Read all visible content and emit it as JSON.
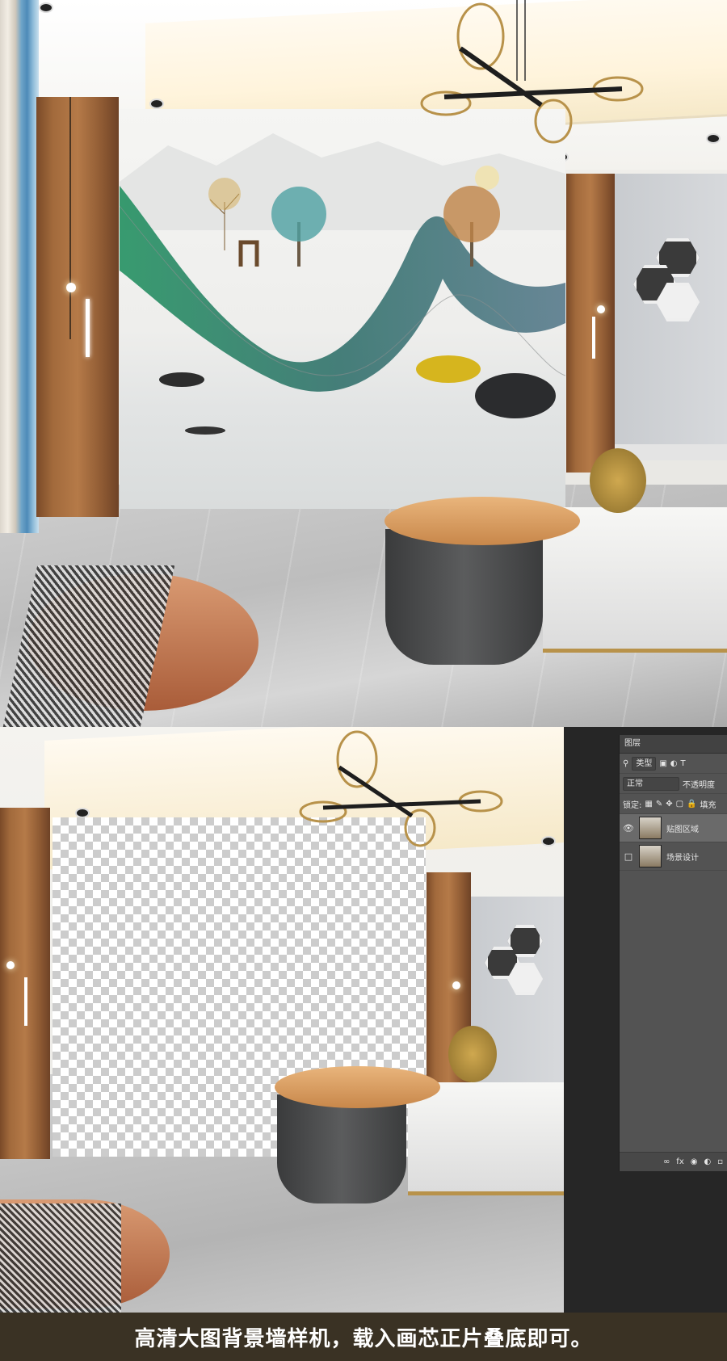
{
  "layers_panel": {
    "tab_title": "图层",
    "filter_kind": "类型",
    "blend_mode": "正常",
    "opacity_label": "不透明度",
    "lock_label": "锁定:",
    "fill_label": "填充",
    "layers": [
      {
        "name": "贴图区域",
        "visible": true,
        "selected": true
      },
      {
        "name": "场景设计",
        "visible": false,
        "selected": false
      }
    ],
    "footer_icons": [
      "link-icon",
      "fx-icon",
      "mask-icon",
      "adjustment-icon",
      "folder-icon"
    ]
  },
  "caption": {
    "text": "高清大图背景墙样机，载入画芯正片叠底即可。"
  },
  "colors": {
    "caption_bg": "#3a3224",
    "panel_bg": "#535353",
    "ps_dark": "#262626"
  }
}
